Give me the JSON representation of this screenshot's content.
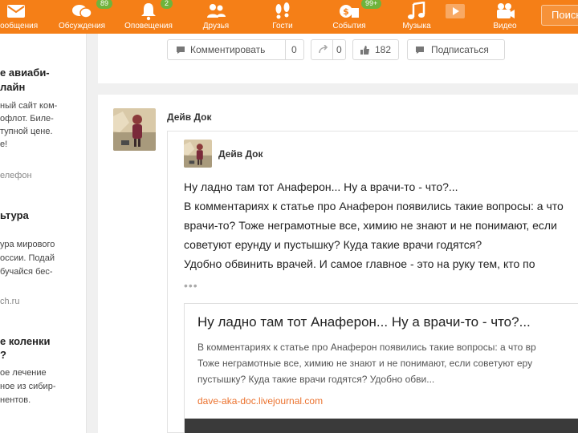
{
  "nav": {
    "items": [
      {
        "label": "Сообщения",
        "badge": ""
      },
      {
        "label": "Обсуждения",
        "badge": "89"
      },
      {
        "label": "Оповещения",
        "badge": "2"
      },
      {
        "label": "Друзья",
        "badge": ""
      },
      {
        "label": "Гости",
        "badge": ""
      },
      {
        "label": "События",
        "badge": "99+"
      },
      {
        "label": "Музыка",
        "badge": ""
      },
      {
        "label": "Видео",
        "badge": ""
      }
    ],
    "search_label": "Поиск"
  },
  "ads": [
    {
      "title_lines": [
        "е авиаби-",
        "лайн"
      ],
      "text_lines": [
        "ный сайт ком-",
        "офлот. Биле-",
        "тупной цене.",
        "е!"
      ],
      "link": "елефон"
    },
    {
      "title_lines": [
        "ьтура"
      ],
      "text_lines": [
        "ура мирового",
        "оссии. Подай",
        "бучайся бес-"
      ],
      "link": "ch.ru"
    },
    {
      "title_lines": [
        "е коленки",
        "?"
      ],
      "text_lines": [
        "ое лечение",
        "ное из сибир-",
        "нентов."
      ],
      "link": ""
    }
  ],
  "actions": {
    "comment_label": "Комментировать",
    "comment_count": "0",
    "reshare_count": "0",
    "like_count": "182",
    "subscribe_label": "Подписаться"
  },
  "post": {
    "author": "Дейв Док",
    "repost_author": "Дейв Док",
    "lines": [
      "Ну ладно там тот Анаферон... Ну а врачи-то - что?...",
      "В комментариях к статье про Анаферон появились такие вопросы: а что",
      "врачи-то? Тоже неграмотные все, химию не знают и не понимают, если",
      "советуют ерунду и пустышку? Куда такие врачи годятся?",
      "Удобно обвинить врачей. И самое главное - это на руку тем, кто по"
    ],
    "more": "•••",
    "preview": {
      "title": "Ну ладно там тот Анаферон... Ну а врачи-то - что?...",
      "lines": [
        "В комментариях к статье про Анаферон появились такие вопросы: а что вр",
        "Тоже неграмотные все, химию не знают и не понимают, если советуют еру",
        "пустышку? Куда такие врачи годятся? Удобно обви..."
      ],
      "link": "dave-aka-doc.livejournal.com"
    }
  },
  "colors": {
    "brand": "#f57f17",
    "badge": "#6fb33c",
    "link": "#eb722e"
  }
}
